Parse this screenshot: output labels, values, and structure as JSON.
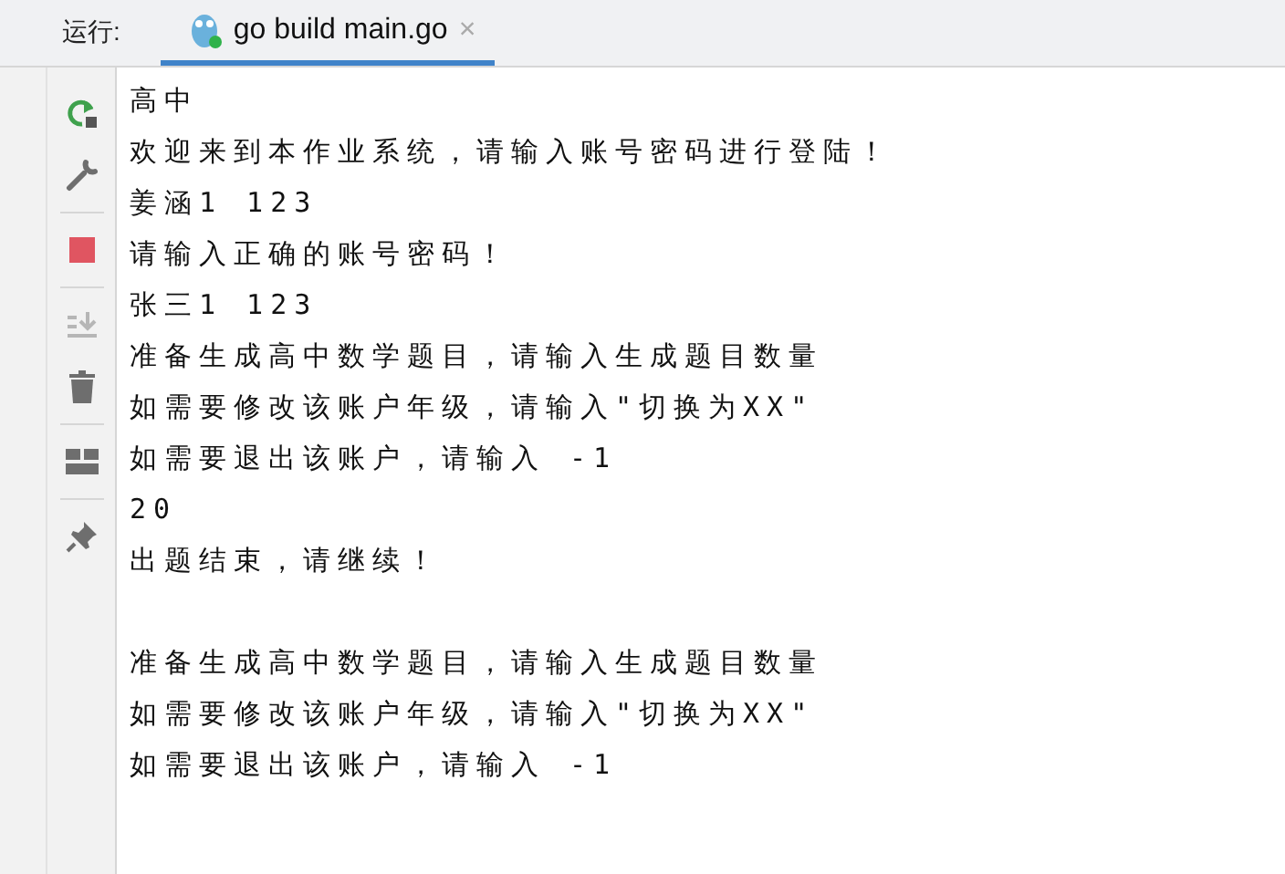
{
  "run_bar": {
    "label": "运行:",
    "tabs": [
      {
        "title": "go build main.go",
        "close": "×",
        "selected": true
      }
    ]
  },
  "toolbar": [
    {
      "kind": "rerun",
      "disabled": false
    },
    {
      "kind": "wrench",
      "disabled": false
    },
    {
      "kind": "separator"
    },
    {
      "kind": "stop",
      "disabled": false
    },
    {
      "kind": "separator"
    },
    {
      "kind": "scroll-end",
      "disabled": true
    },
    {
      "kind": "trash",
      "disabled": false
    },
    {
      "kind": "separator"
    },
    {
      "kind": "layout",
      "disabled": false
    },
    {
      "kind": "separator"
    },
    {
      "kind": "pin",
      "disabled": false
    }
  ],
  "console_blocks": [
    {
      "lines": [
        "高中",
        "欢迎来到本作业系统，请输入账号密码进行登陆！",
        "姜涵1 123",
        "请输入正确的账号密码！",
        "张三1 123",
        "准备生成高中数学题目，请输入生成题目数量",
        "如需要修改该账户年级，请输入\"切换为XX\"",
        "如需要退出该账户，请输入 -1",
        "20",
        "出题结束，请继续！"
      ]
    },
    {
      "lines": [
        "准备生成高中数学题目，请输入生成题目数量",
        "如需要修改该账户年级，请输入\"切换为XX\"",
        "如需要退出该账户，请输入 -1"
      ]
    }
  ]
}
